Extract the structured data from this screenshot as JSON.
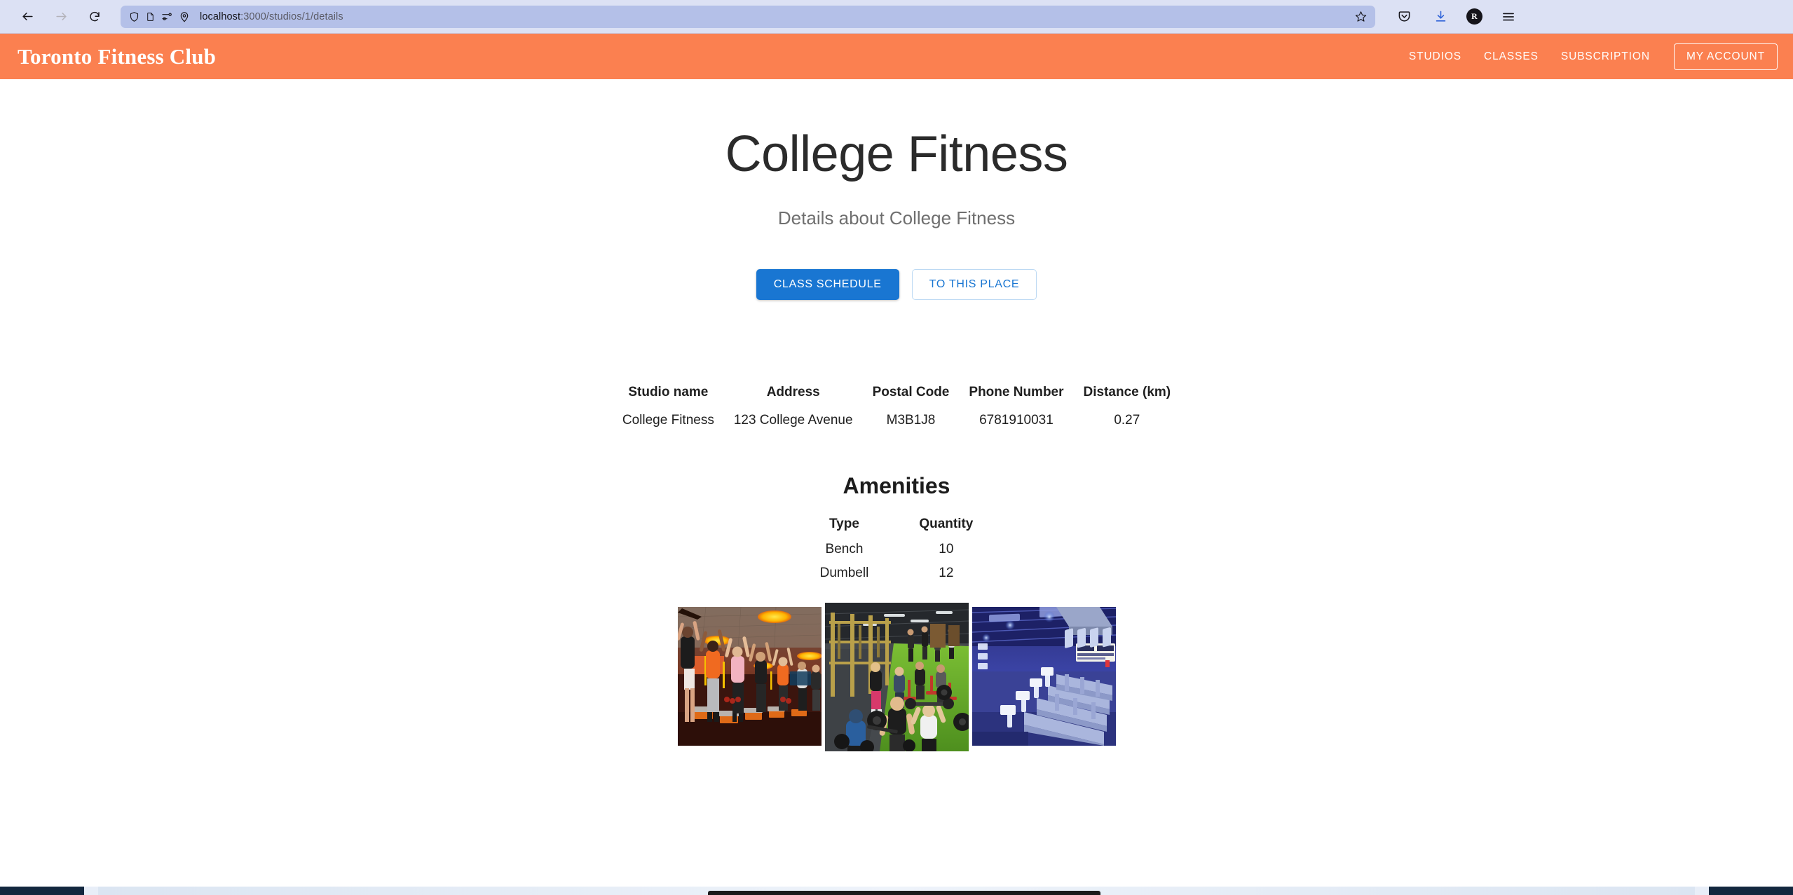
{
  "browser": {
    "back_icon": "back-arrow-icon",
    "forward_icon": "forward-arrow-icon",
    "reload_icon": "reload-icon",
    "url_host": "localhost",
    "url_path": ":3000/studios/1/details",
    "url_full": "localhost:3000/studios/1/details",
    "urlbar_icons": [
      "shield-icon",
      "reader-view-icon",
      "permissions-icon",
      "location-pin-icon"
    ],
    "bookmark_icon": "star-icon",
    "toolbar_icons": [
      "pocket-icon",
      "downloads-icon"
    ],
    "account_initial": "R",
    "menu_icon": "hamburger-menu-icon"
  },
  "navbar": {
    "brand": "Toronto Fitness Club",
    "links": [
      {
        "label": "STUDIOS"
      },
      {
        "label": "CLASSES"
      },
      {
        "label": "SUBSCRIPTION"
      }
    ],
    "account_button": "MY ACCOUNT",
    "background_color": "#fb8050"
  },
  "hero": {
    "title": "College Fitness",
    "subtitle": "Details about College Fitness",
    "primary_button": "CLASS SCHEDULE",
    "secondary_button": "TO THIS PLACE",
    "primary_color": "#1976d2"
  },
  "studio_table": {
    "headers": [
      "Studio name",
      "Address",
      "Postal Code",
      "Phone Number",
      "Distance (km)"
    ],
    "rows": [
      [
        "College Fitness",
        "123 College Avenue",
        "M3B1J8",
        "6781910031",
        "0.27"
      ]
    ]
  },
  "amenities": {
    "title": "Amenities",
    "headers": [
      "Type",
      "Quantity"
    ],
    "rows": [
      [
        "Bench",
        "10"
      ],
      [
        "Dumbell",
        "12"
      ]
    ]
  },
  "gallery": {
    "photos": [
      {
        "name": "studio-photo-group-class"
      },
      {
        "name": "studio-photo-weight-floor"
      },
      {
        "name": "studio-photo-cardio-room"
      }
    ]
  }
}
